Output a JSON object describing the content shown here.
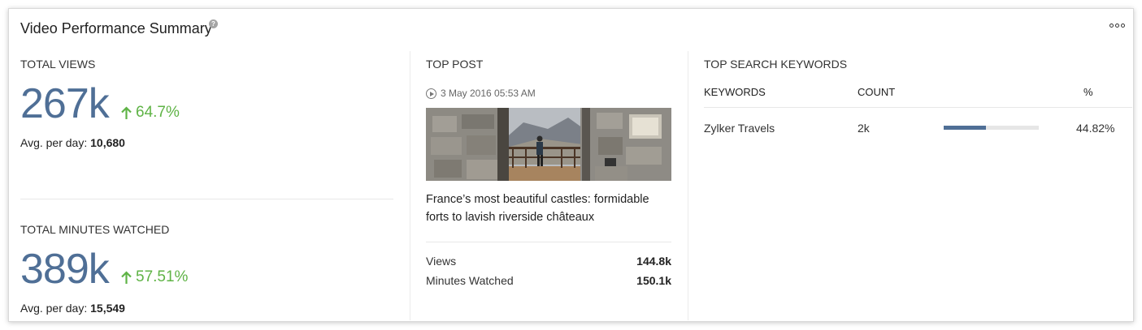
{
  "widget": {
    "title": "Video Performance Summary",
    "help_icon": "question-icon",
    "more_icon": "more-options-icon"
  },
  "total_views": {
    "label": "TOTAL VIEWS",
    "value": "267k",
    "change": "64.7%",
    "avg_label": "Avg. per day:",
    "avg_value": "10,680"
  },
  "total_minutes": {
    "label": "TOTAL MINUTES WATCHED",
    "value": "389k",
    "change": "57.51%",
    "avg_label": "Avg. per day:",
    "avg_value": "15,549"
  },
  "top_post": {
    "label": "TOP POST",
    "date": "3 May 2016 05:53 AM",
    "title": "France’s most beautiful castles: formidable forts to lavish riverside châteaux",
    "stats": [
      {
        "label": "Views",
        "value": "144.8k"
      },
      {
        "label": "Minutes Watched",
        "value": "150.1k"
      }
    ]
  },
  "keywords": {
    "label": "TOP SEARCH KEYWORDS",
    "columns": {
      "keyword": "KEYWORDS",
      "count": "COUNT",
      "percent": "%"
    },
    "rows": [
      {
        "keyword": "Zylker Travels",
        "count": "2k",
        "percent": "44.82%",
        "share": 0.4482
      }
    ]
  },
  "colors": {
    "accent": "#4f6f96",
    "positive": "#5fb346"
  }
}
